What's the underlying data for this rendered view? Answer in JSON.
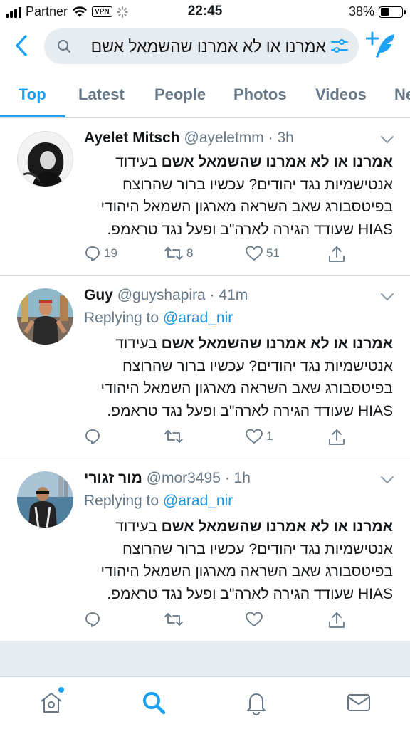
{
  "status_bar": {
    "carrier": "Partner",
    "vpn": "VPN",
    "time": "22:45",
    "battery": "38%",
    "battery_level": 0.38
  },
  "search": {
    "query": "אמרנו או לא אמרנו שהשמאל אשם"
  },
  "tabs": [
    "Top",
    "Latest",
    "People",
    "Photos",
    "Videos",
    "Ne"
  ],
  "active_tab": "Top",
  "accent": "#1da1f2",
  "tweets": [
    {
      "name": "Ayelet Mitsch",
      "handle": "@ayeletmm",
      "time": "· 3h",
      "replying_label": "",
      "replying_to": "",
      "text_bold": "אמרנו או לא אמרנו שהשמאל אשם",
      "text_rest": " בעידוד אנטישמיות נגד יהודים? עכשיו ברור שהרוצח בפיטסבורג שאב השראה מארגון השמאל היהודי HIAS שעודד הגירה לארה\"ב ופעל נגד טראמפ.",
      "replies": "19",
      "retweets": "8",
      "likes": "51"
    },
    {
      "name": "Guy",
      "handle": "@guyshapira",
      "time": "· 41m",
      "replying_label": "Replying to ",
      "replying_to": "@arad_nir",
      "text_bold": "אמרנו או לא אמרנו שהשמאל אשם",
      "text_rest": " בעידוד אנטישמיות נגד יהודים? עכשיו ברור שהרוצח בפיטסבורג שאב השראה מארגון השמאל היהודי HIAS שעודד הגירה לארה\"ב ופעל נגד טראמפ.",
      "replies": "",
      "retweets": "",
      "likes": "1"
    },
    {
      "name": "מור זגורי",
      "handle": "@mor3495",
      "time": "· 1h",
      "replying_label": "Replying to ",
      "replying_to": "@arad_nir",
      "text_bold": "אמרנו או לא אמרנו שהשמאל אשם",
      "text_rest": " בעידוד אנטישמיות נגד יהודים? עכשיו ברור שהרוצח בפיטסבורג שאב השראה מארגון השמאל היהודי HIAS שעודד הגירה לארה\"ב ופעל נגד טראמפ.",
      "replies": "",
      "retweets": "",
      "likes": ""
    }
  ],
  "bottom_nav": [
    "home-icon",
    "search-icon",
    "notifications-icon",
    "messages-icon"
  ]
}
